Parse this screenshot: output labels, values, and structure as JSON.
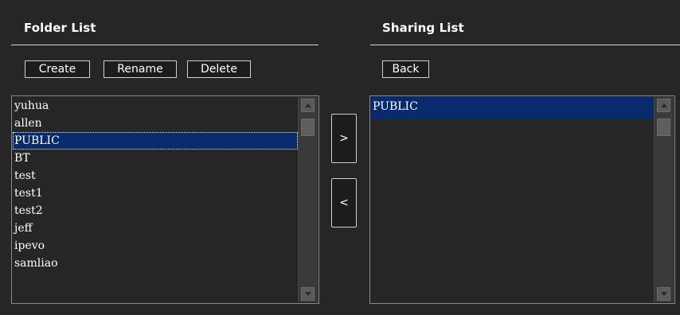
{
  "folder_panel": {
    "title": "Folder List",
    "buttons": {
      "create": "Create",
      "rename": "Rename",
      "delete": "Delete"
    },
    "items": [
      "yuhua",
      "allen",
      "PUBLIC",
      "BT",
      "test",
      "test1",
      "test2",
      "jeff",
      "ipevo",
      "samliao"
    ],
    "selected_item": "PUBLIC"
  },
  "sharing_panel": {
    "title": "Sharing List",
    "buttons": {
      "back": "Back"
    },
    "items": [
      "PUBLIC"
    ],
    "selected_item": "PUBLIC"
  },
  "transfer": {
    "add_label": ">",
    "remove_label": "<"
  },
  "colors": {
    "background": "#262626",
    "selection": "#0a2a6e",
    "border": "#cfcfcf"
  }
}
